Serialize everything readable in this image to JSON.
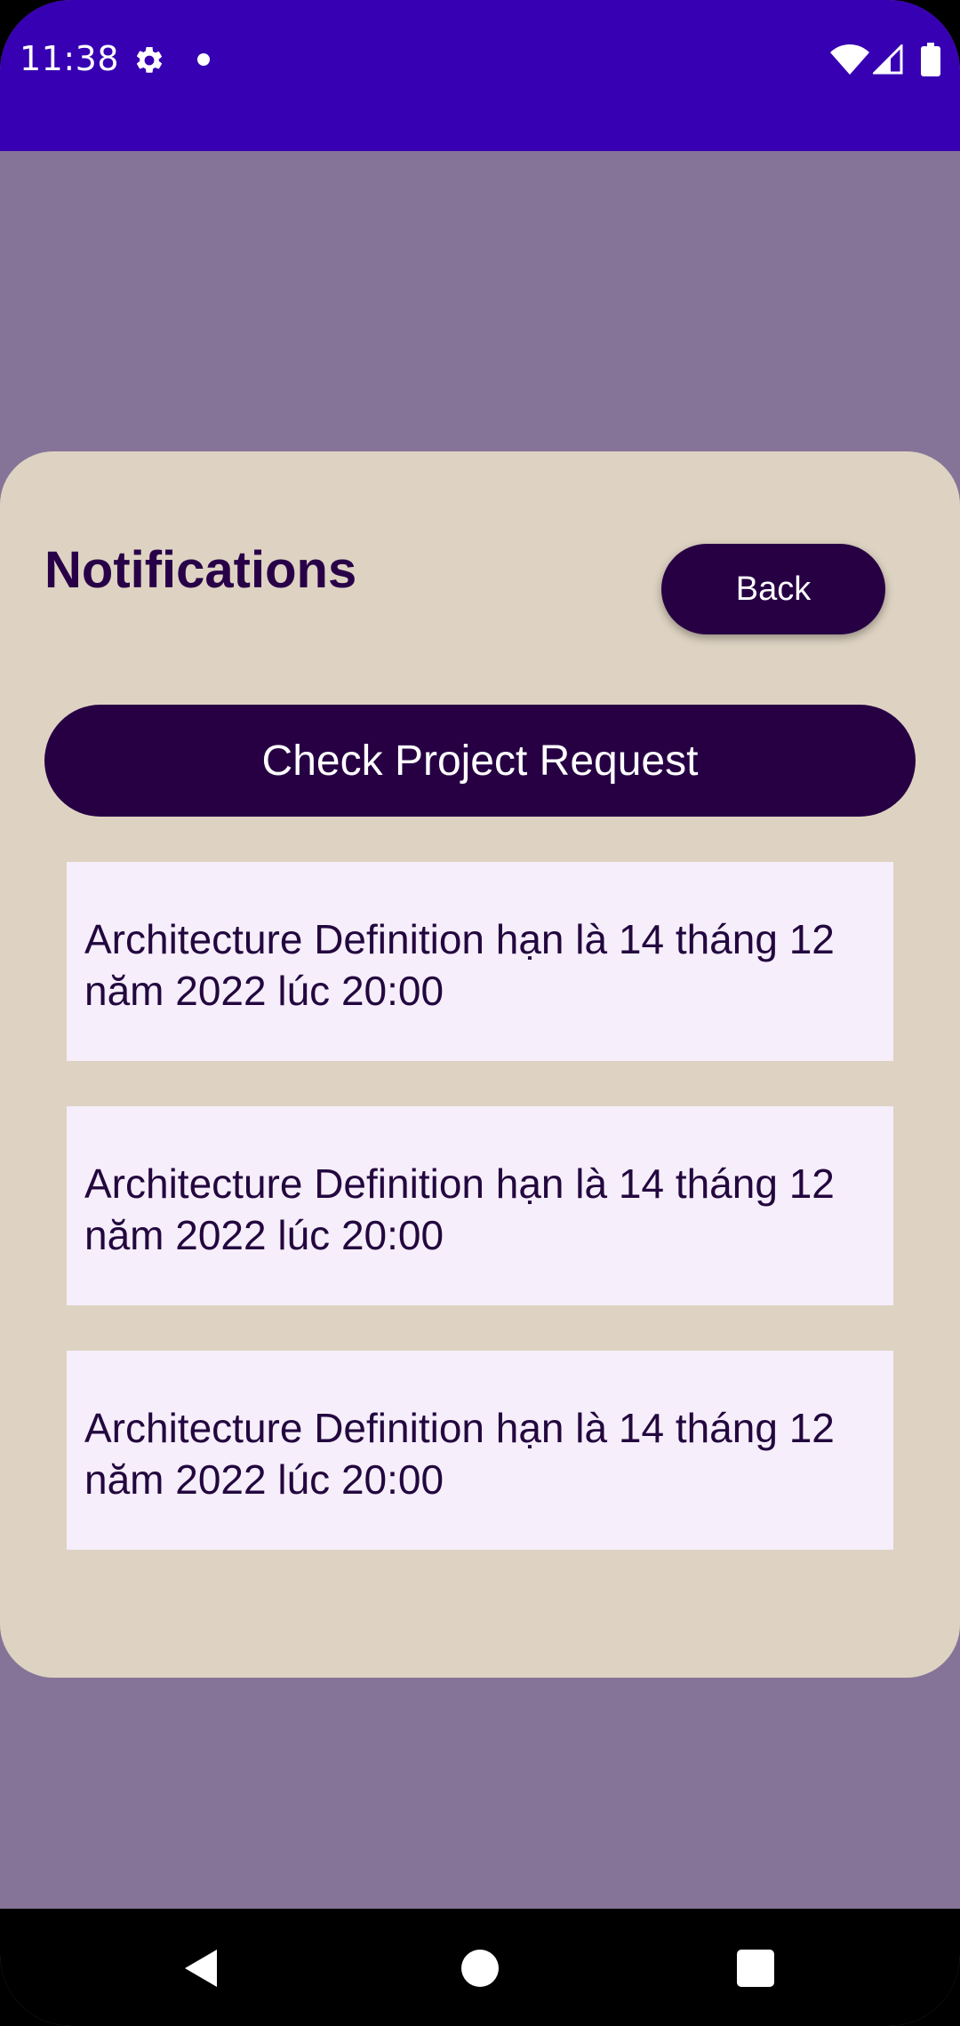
{
  "status_bar": {
    "time": "11:38",
    "icons": [
      "gear-icon",
      "dot-icon",
      "wifi-icon",
      "signal-icon",
      "battery-icon"
    ]
  },
  "colors": {
    "status_bar": "#3700B3",
    "background": "#867498",
    "card": "#DED3C2",
    "button": "#270044",
    "list_item": "#F6EEFA",
    "text": "#23073F"
  },
  "header": {
    "title": "Notifications",
    "back_label": "Back"
  },
  "actions": {
    "check_project_request_label": "Check Project Request"
  },
  "notifications": [
    {
      "text": "Architecture Definition hạn là 14 tháng 12 năm 2022 lúc 20:00"
    },
    {
      "text": "Architecture Definition hạn là 14 tháng 12 năm 2022 lúc 20:00"
    },
    {
      "text": "Architecture Definition hạn là 14 tháng 12 năm 2022 lúc 20:00"
    }
  ],
  "nav_bar": {
    "icons": [
      "back-triangle-icon",
      "home-circle-icon",
      "recents-square-icon"
    ]
  }
}
